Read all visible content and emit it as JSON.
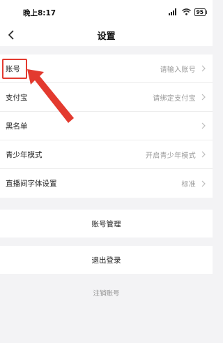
{
  "status_bar": {
    "time": "晚上8:17",
    "signal": "signal-bars-icon",
    "wifi": "wifi-icon",
    "battery": "95"
  },
  "header": {
    "title": "设置",
    "back_icon": "chevron-left-icon"
  },
  "settings": [
    {
      "label": "账号",
      "value": "请输入账号"
    },
    {
      "label": "支付宝",
      "value": "请绑定支付宝"
    },
    {
      "label": "黑名单",
      "value": ""
    },
    {
      "label": "青少年模式",
      "value": "开启青少年模式"
    },
    {
      "label": "直播间字体设置",
      "value": "标准"
    }
  ],
  "actions": {
    "account_manage": "账号管理",
    "logout": "退出登录",
    "cancel_account": "注销账号"
  },
  "annotation": {
    "color": "#e33a2f"
  }
}
